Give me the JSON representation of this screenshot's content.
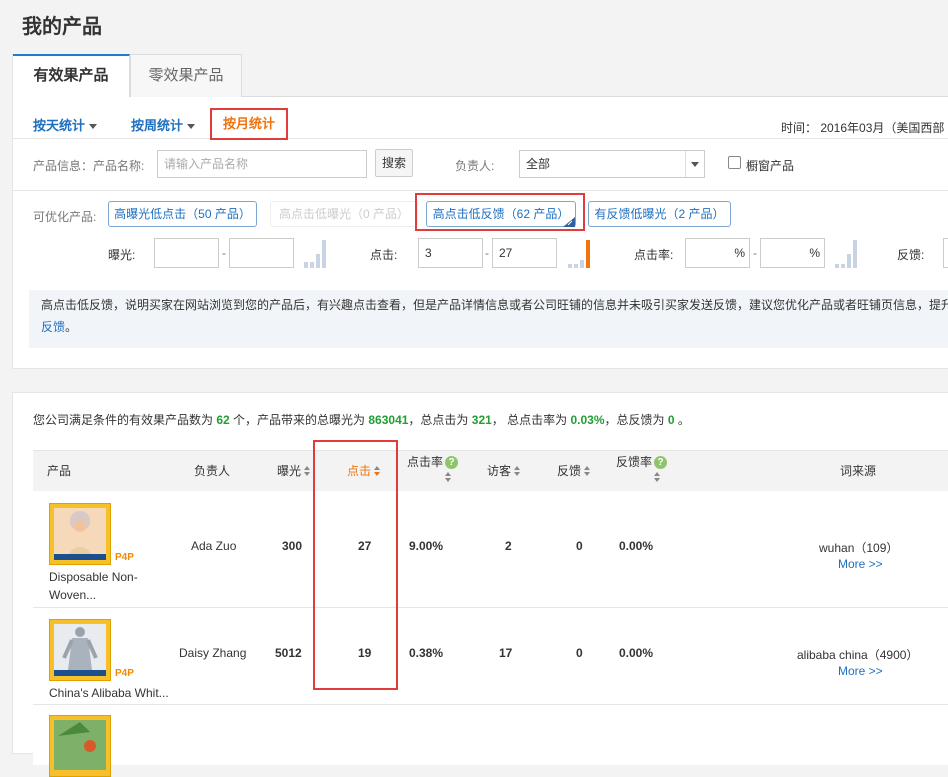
{
  "page": {
    "title": "我的产品"
  },
  "tabs": [
    "有效果产品",
    "零效果产品"
  ],
  "stat_tabs": {
    "day": "按天统计",
    "week": "按周统计",
    "month": "按月统计"
  },
  "time_label": "时间： 2016年03月（美国西部",
  "filter": {
    "product_info_label": "产品信息：",
    "product_name_label": "产品名称:",
    "product_name_placeholder": "请输入产品名称",
    "search_button": "搜索",
    "owner_label": "负责人:",
    "owner_value": "全部",
    "window_product_label": "橱窗产品"
  },
  "optimize": {
    "label": "可优化产品:",
    "options": [
      {
        "label": "高曝光低点击（50 产品）"
      },
      {
        "label": "高点击低曝光（0 产品）"
      },
      {
        "label": "高点击低反馈（62 产品）"
      },
      {
        "label": "有反馈低曝光（2 产品）"
      }
    ]
  },
  "ranges": {
    "exposure_label": "曝光:",
    "exposure_min": "",
    "exposure_max": "",
    "click_label": "点击:",
    "click_min": "3",
    "click_max": "27",
    "ctr_label": "点击率:",
    "feedback_label": "反馈:",
    "dash": "-",
    "pct": "%"
  },
  "info_text_1": "高点击低反馈，说明买家在网站浏览到您的产品后，有兴趣点击查看，但是产品详情信息或者公司旺铺的信息并未吸引买家发送反馈，建议您优化产品或者旺铺页信息，提升",
  "info_text_2": "反馈",
  "info_text_3": "。",
  "summary": {
    "p1": "您公司满足条件的有效果产品数为 ",
    "count": "62",
    "p2": " 个，产品带来的总曝光为 ",
    "exposure": "863041",
    "p3": "，总点击为 ",
    "clicks": "321",
    "p4": "， 总点击率为 ",
    "ctr": "0.03%",
    "p5": "，总反馈为 ",
    "feedback": "0",
    "p6": " 。"
  },
  "table": {
    "headers": {
      "product": "产品",
      "owner": "负责人",
      "exposure": "曝光",
      "clicks": "点击",
      "ctr": "点击率",
      "visitors": "访客",
      "feedback": "反馈",
      "feedback_rate": "反馈率",
      "keyword_source": "词来源",
      "help": "?"
    },
    "p4p": "P4P",
    "more": "More >>",
    "rows": [
      {
        "name1": "Disposable Non-",
        "name2": "Woven...",
        "owner": "Ada Zuo",
        "exposure": "300",
        "clicks": "27",
        "ctr": "9.00%",
        "visitors": "2",
        "feedback": "0",
        "feedback_rate": "0.00%",
        "keyword": "wuhan（109）"
      },
      {
        "name1": "China's Alibaba Whit...",
        "name2": "",
        "owner": "Daisy Zhang",
        "exposure": "5012",
        "clicks": "19",
        "ctr": "0.38%",
        "visitors": "17",
        "feedback": "0",
        "feedback_rate": "0.00%",
        "keyword": "alibaba china（4900）"
      }
    ]
  },
  "colors": {
    "accent": "#1e6fc1",
    "orange": "#f0730e",
    "green": "#1fa031",
    "highlight": "#e03c3c"
  }
}
